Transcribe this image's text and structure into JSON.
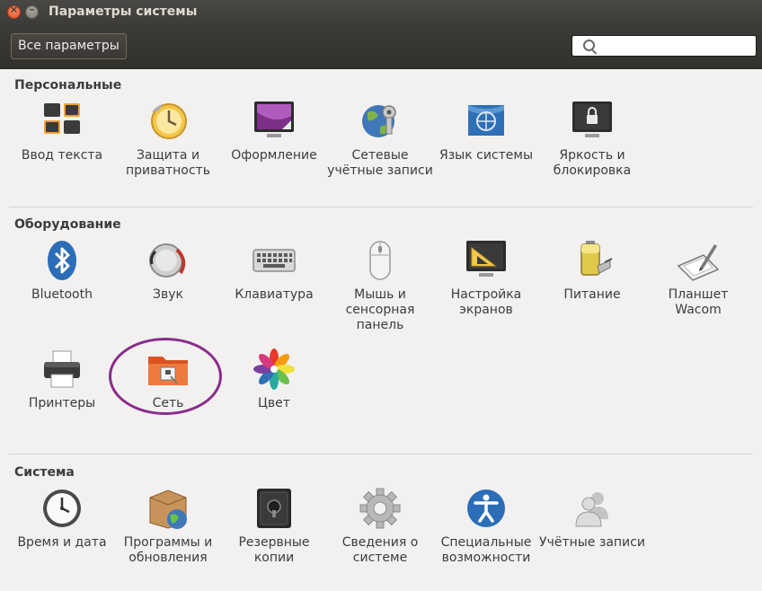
{
  "window": {
    "title": "Параметры системы",
    "close_glyph": "×",
    "minimize_glyph": "–"
  },
  "toolbar": {
    "all_settings_label": "Все параметры",
    "search_placeholder": ""
  },
  "sections": {
    "personal": {
      "title": "Персональные",
      "items": [
        {
          "label": "Ввод текста",
          "icon": "keyboard-input-icon"
        },
        {
          "label": "Защита и приватность",
          "icon": "privacy-clock-icon"
        },
        {
          "label": "Оформление",
          "icon": "appearance-monitor-icon"
        },
        {
          "label": "Сетевые учётные записи",
          "icon": "online-accounts-icon"
        },
        {
          "label": "Язык системы",
          "icon": "language-flag-icon"
        },
        {
          "label": "Яркость и блокировка",
          "icon": "lock-monitor-icon"
        }
      ]
    },
    "hardware": {
      "title": "Оборудование",
      "items": [
        {
          "label": "Bluetooth",
          "icon": "bluetooth-icon"
        },
        {
          "label": "Звук",
          "icon": "speaker-icon"
        },
        {
          "label": "Клавиатура",
          "icon": "keyboard-icon"
        },
        {
          "label": "Мышь и сенсорная панель",
          "icon": "mouse-icon"
        },
        {
          "label": "Настройка экранов",
          "icon": "display-icon"
        },
        {
          "label": "Питание",
          "icon": "battery-icon"
        },
        {
          "label": "Планшет Wacom",
          "icon": "tablet-icon"
        },
        {
          "label": "Принтеры",
          "icon": "printer-icon"
        },
        {
          "label": "Сеть",
          "icon": "network-folder-icon"
        },
        {
          "label": "Цвет",
          "icon": "color-flower-icon"
        }
      ]
    },
    "system": {
      "title": "Система",
      "items": [
        {
          "label": "Время и дата",
          "icon": "clock-icon"
        },
        {
          "label": "Программы и обновления",
          "icon": "software-updates-icon"
        },
        {
          "label": "Резервные копии",
          "icon": "backup-safe-icon"
        },
        {
          "label": "Сведения о системе",
          "icon": "gear-icon"
        },
        {
          "label": "Специальные возможности",
          "icon": "accessibility-icon"
        },
        {
          "label": "Учётные записи",
          "icon": "user-accounts-icon"
        }
      ]
    }
  }
}
